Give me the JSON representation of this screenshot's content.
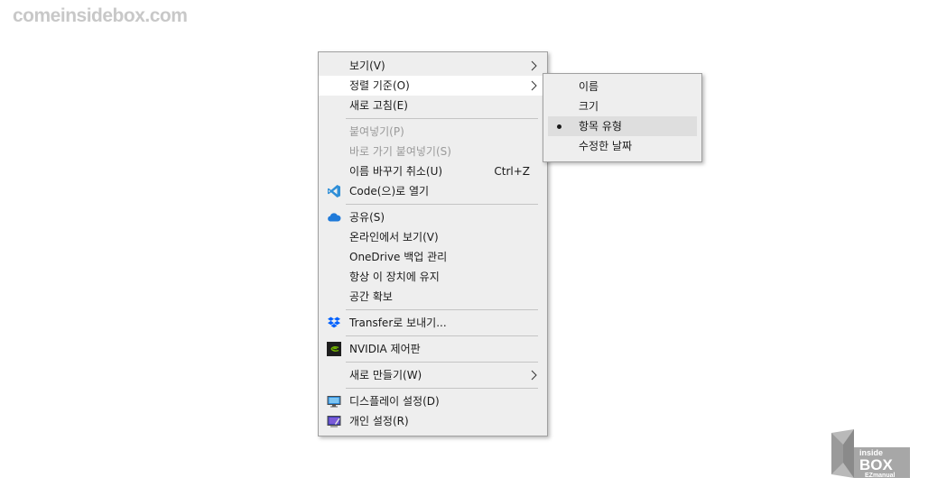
{
  "watermark": "comeinsidebox.com",
  "context_menu": {
    "view": "보기(V)",
    "sort_by": "정렬 기준(O)",
    "refresh": "새로 고침(E)",
    "paste": "붙여넣기(P)",
    "paste_shortcut": "바로 가기 붙여넣기(S)",
    "undo_rename": "이름 바꾸기 취소(U)",
    "undo_shortcut_key": "Ctrl+Z",
    "open_with_code": "Code(으)로 열기",
    "share": "공유(S)",
    "view_online": "온라인에서 보기(V)",
    "onedrive_backup": "OneDrive 백업 관리",
    "always_keep": "항상 이 장치에 유지",
    "free_space": "공간 확보",
    "transfer": "Transfer로 보내기...",
    "nvidia": "NVIDIA 제어판",
    "new": "새로 만들기(W)",
    "display_settings": "디스플레이 설정(D)",
    "personalize": "개인 설정(R)"
  },
  "sort_submenu": {
    "name": "이름",
    "size": "크기",
    "item_type": "항목 유형",
    "date_modified": "수정한 날짜",
    "checked_item": "항목 유형"
  },
  "logo": {
    "top": "inside",
    "middle": "BOX",
    "bottom": "EZmanual"
  },
  "colors": {
    "menu_bg": "#eeeeee",
    "hover_bg": "#ffffff",
    "checked_bg": "#dedede",
    "vscode_blue": "#2f8fd8",
    "onedrive_blue": "#1f7ad9",
    "dropbox_blue": "#0061fe",
    "nvidia_green": "#76b900"
  }
}
